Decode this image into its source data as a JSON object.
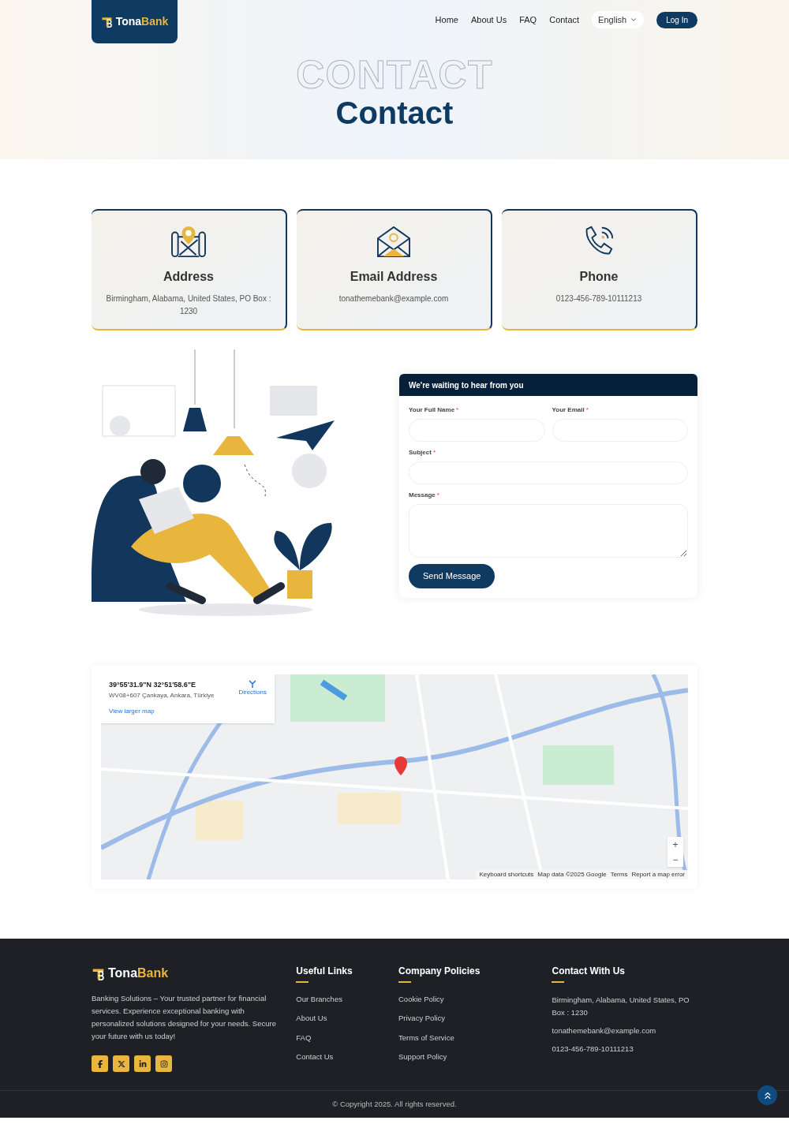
{
  "header": {
    "logo": {
      "first": "Tona",
      "second": "Bank"
    },
    "nav": [
      {
        "label": "Home",
        "selected": false
      },
      {
        "label": "About Us",
        "selected": false
      },
      {
        "label": "FAQ",
        "selected": false
      },
      {
        "label": "Contact",
        "selected": false
      }
    ],
    "language": "English",
    "login": "Log In"
  },
  "hero": {
    "outline_text": "CONTACT",
    "title": "Contact"
  },
  "info_cards": [
    {
      "kind": "address",
      "title": "Address",
      "text": "Birmingham, Alabama, United States, PO Box : 1230"
    },
    {
      "kind": "email",
      "title": "Email Address",
      "text": "tonathemebank@example.com"
    },
    {
      "kind": "phone",
      "title": "Phone",
      "text": "0123-456-789-10111213"
    }
  ],
  "form": {
    "title": "We're waiting to hear from you",
    "fields": [
      {
        "kind": "half",
        "label": "Your Full Name",
        "mark": "*"
      },
      {
        "kind": "half",
        "label": "Your Email",
        "mark": "*"
      },
      {
        "kind": "full",
        "label": "Subject",
        "mark": "*"
      },
      {
        "kind": "textarea",
        "label": "Message",
        "mark": "*"
      }
    ],
    "submit": "Send Message"
  },
  "map": {
    "coordinates": "39°55'31.9\"N 32°51'58.6\"E",
    "place": "WV08+607 Çankaya, Ankara, Türkiye",
    "directions": "Directions",
    "larger_map": "View larger map",
    "zoom_in": "+",
    "zoom_out": "−",
    "attribution": [
      "Keyboard shortcuts",
      "Map data ©2025 Google",
      "Terms",
      "Report a map error"
    ]
  },
  "footer": {
    "logo": {
      "first": "Tona",
      "second": "Bank"
    },
    "about": "Banking Solutions – Your trusted partner for financial services. Experience exceptional banking with personalized solutions designed for your needs. Secure your future with us today!",
    "socials": [
      {
        "kind": "facebook"
      },
      {
        "kind": "x"
      },
      {
        "kind": "linkedin"
      },
      {
        "kind": "instagram"
      }
    ],
    "columns": [
      {
        "title": "Useful Links",
        "links": [
          "Our Branches",
          "About Us",
          "FAQ",
          "Contact Us"
        ]
      },
      {
        "title": "Company Policies",
        "links": [
          "Cookie Policy",
          "Privacy Policy",
          "Terms of Service",
          "Support Policy"
        ]
      }
    ],
    "contact": {
      "title": "Contact With Us",
      "lines": [
        "Birmingham, Alabama, United States, PO Box : 1230",
        "tonathemebank@example.com",
        "0123-456-789-10111213"
      ]
    },
    "copyright": "© Copyright 2025. All rights reserved."
  }
}
